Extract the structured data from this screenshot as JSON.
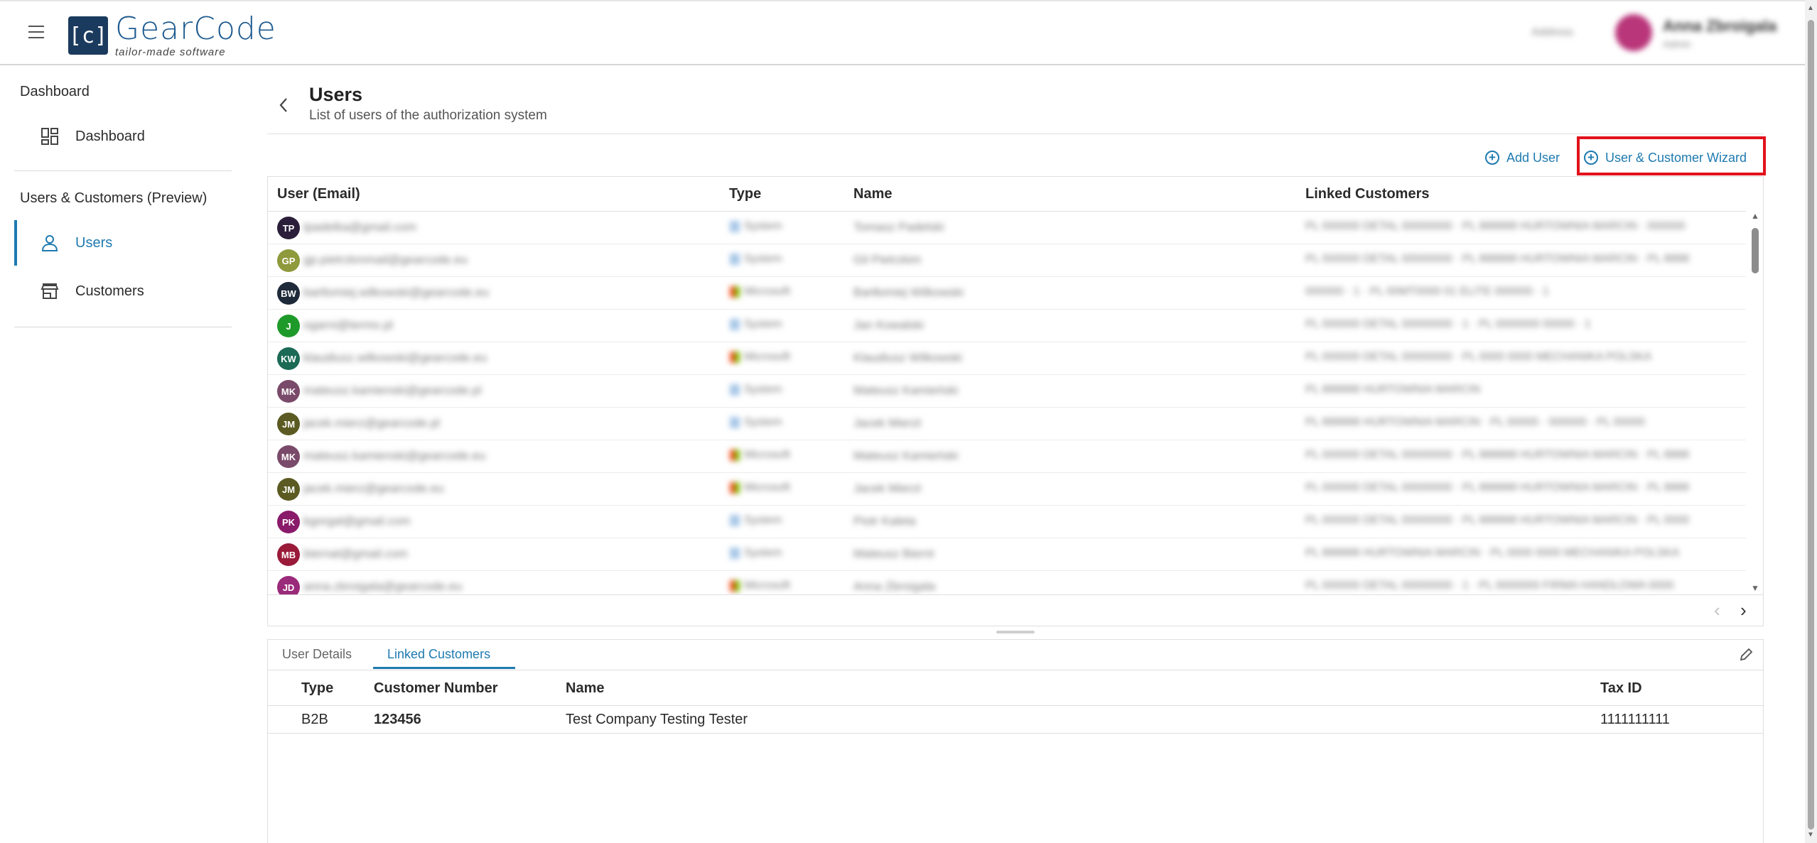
{
  "app": {
    "logo_name": "GearCode",
    "logo_tagline": "tailor-made software",
    "header_right_label": "Address",
    "user_name": "Anna Zbroigala",
    "user_role": "Admin"
  },
  "sidebar": {
    "sections": [
      {
        "title": "Dashboard",
        "items": [
          {
            "label": "Dashboard",
            "icon": "dashboard-icon"
          }
        ]
      },
      {
        "title": "Users & Customers (Preview)",
        "items": [
          {
            "label": "Users",
            "icon": "person-icon",
            "active": true
          },
          {
            "label": "Customers",
            "icon": "store-icon"
          }
        ]
      }
    ]
  },
  "page": {
    "title": "Users",
    "subtitle": "List of users of the authorization system"
  },
  "toolbar": {
    "add_user": "Add User",
    "wizard": "User & Customer Wizard"
  },
  "users_table": {
    "columns": [
      "User (Email)",
      "Type",
      "Name",
      "Linked Customers"
    ],
    "rows": [
      {
        "initials": "TP",
        "avatar_color": "#2a1e3a",
        "email": "tpadelka@gmail.com",
        "type": "System",
        "type_icon": "system",
        "name": "Tomasz Padelski",
        "linked": "PL 000000 DETAL 00000000 · PL 888888 HURTOWNIA MARCIN · 000000"
      },
      {
        "initials": "GP",
        "avatar_color": "#8e9a3c",
        "email": "gp.pietrzkmmail@gearcode.eu",
        "type": "System",
        "type_icon": "system",
        "name": "Gil Pietrzkim",
        "linked": "PL 000000 DETAL 00000000 · PL 888888 HURTOWNIA MARCIN · PL 8888"
      },
      {
        "initials": "BW",
        "avatar_color": "#1e2a3a",
        "email": "bartlomiej.wilkowski@gearcode.eu",
        "type": "Microsoft",
        "type_icon": "microsoft",
        "name": "Bartłomiej Wilkowski",
        "linked": "000000 · 1 · PL 00MT0000 01 ELITE 000000 · 1"
      },
      {
        "initials": "J",
        "avatar_color": "#1e9a2a",
        "email": "ogarni@termo.pl",
        "type": "System",
        "type_icon": "system",
        "name": "Jan Kowalski",
        "linked": "PL 000000 DETAL 00000000 · 1 · PL 0000000 00000 · 1"
      },
      {
        "initials": "KW",
        "avatar_color": "#1b6a55",
        "email": "klaudiusz.wilkowski@gearcode.eu",
        "type": "Microsoft",
        "type_icon": "microsoft",
        "name": "Klaudiusz Wilkowski",
        "linked": "PL 000000 DETAL 00000000 · PL 0000 0000 MECHANIKA POLSKA"
      },
      {
        "initials": "MK",
        "avatar_color": "#7a4a6a",
        "email": "mateusz.kamienski@gearcode.pl",
        "type": "System",
        "type_icon": "system",
        "name": "Mateusz Kamieński",
        "linked": "PL 888888 HURTOWNIA MARCIN"
      },
      {
        "initials": "JM",
        "avatar_color": "#5a5a22",
        "email": "jacek.mierz@gearcode.pl",
        "type": "System",
        "type_icon": "system",
        "name": "Jacek Mierzt",
        "linked": "PL 888888 HURTOWNIA MARCIN · PL 00000 · 000000 · PL 00000"
      },
      {
        "initials": "MK",
        "avatar_color": "#7a4a6a",
        "email": "mateusz.kamienski@gearcode.eu",
        "type": "Microsoft",
        "type_icon": "microsoft",
        "name": "Mateusz Kamieński",
        "linked": "PL 000000 DETAL 00000000 · PL 888888 HURTOWNIA MARCIN · PL 8888"
      },
      {
        "initials": "JM",
        "avatar_color": "#5a5a22",
        "email": "jacek.mierz@gearcode.eu",
        "type": "Microsoft",
        "type_icon": "microsoft",
        "name": "Jacek Mierzt",
        "linked": "PL 000000 DETAL 00000000 · PL 888888 HURTOWNIA MARCIN · PL 8888"
      },
      {
        "initials": "PK",
        "avatar_color": "#8a1a6a",
        "email": "kgorgal@gmail.com",
        "type": "System",
        "type_icon": "system",
        "name": "Piotr Kaleta",
        "linked": "PL 000000 DETAL 00000000 · PL 888888 HURTOWNIA MARCIN · PL 0000"
      },
      {
        "initials": "MB",
        "avatar_color": "#9a1a3a",
        "email": "biernat@gmail.com",
        "type": "System",
        "type_icon": "system",
        "name": "Mateusz Biernt",
        "linked": "PL 888888 HURTOWNIA MARCIN · PL 0000 0000 MECHANIKA POLSKA"
      },
      {
        "initials": "JD",
        "avatar_color": "#9a2a7a",
        "email": "anna.zbroigala@gearcode.eu",
        "type": "Microsoft",
        "type_icon": "microsoft",
        "name": "Anna Zbroigala",
        "linked": "PL 000000 DETAL 00000000 · 1 · PL 0000000 FIRMA HANDLOWA 0000"
      }
    ]
  },
  "details": {
    "tabs": [
      {
        "label": "User Details",
        "active": false
      },
      {
        "label": "Linked Customers",
        "active": true
      }
    ],
    "linked_customers": {
      "columns": [
        "Type",
        "Customer Number",
        "Name",
        "Tax ID"
      ],
      "rows": [
        {
          "type": "B2B",
          "customer_number": "123456",
          "name": "Test Company Testing Tester",
          "tax_id": "1111111111"
        }
      ]
    }
  },
  "colors": {
    "accent": "#1e7ab0",
    "highlight": "#e2121c",
    "logo_box": "#1b3b5e"
  }
}
